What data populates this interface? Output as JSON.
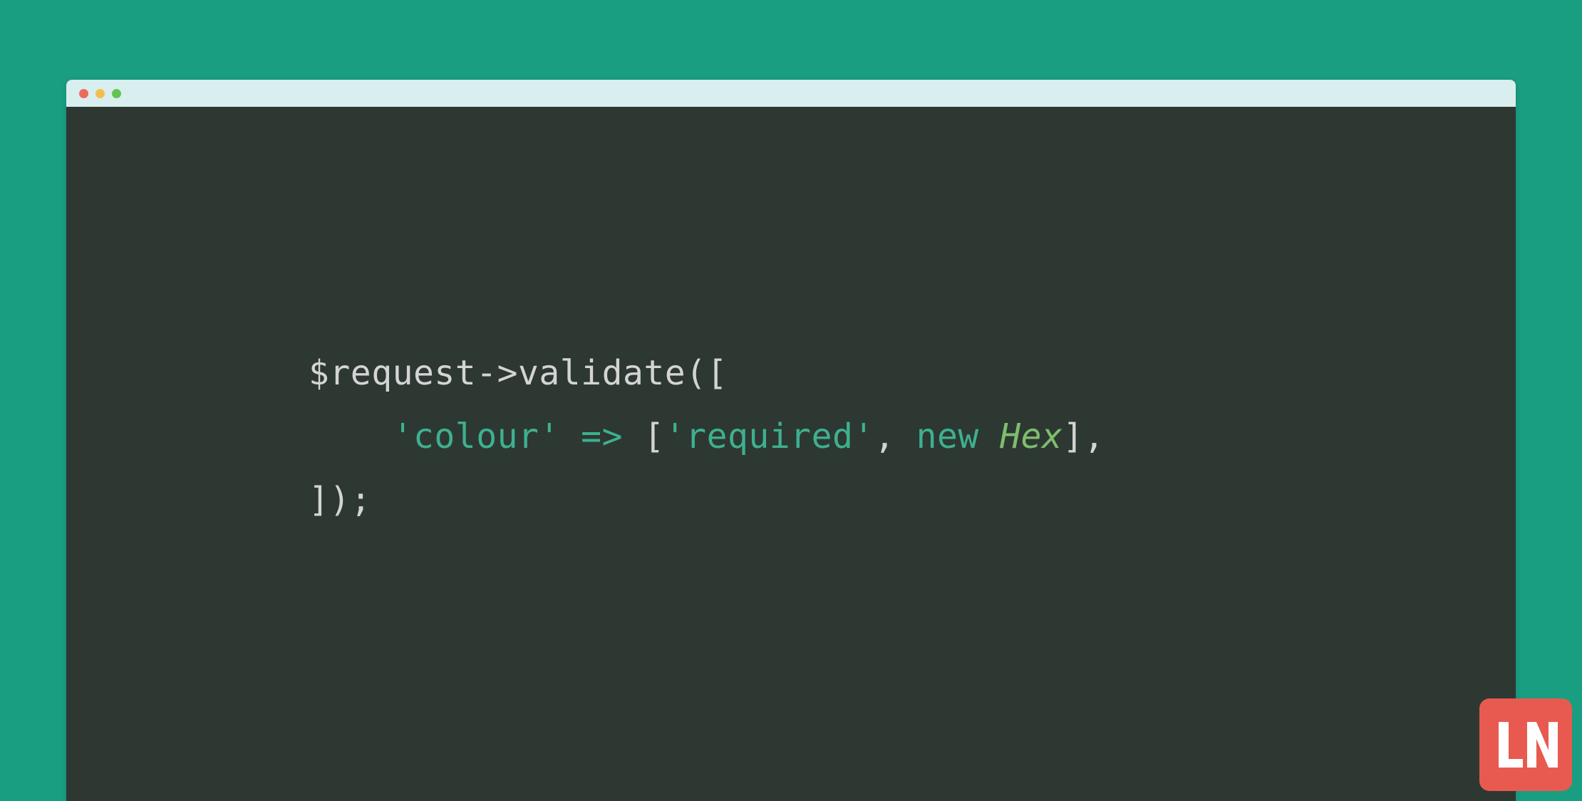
{
  "code": {
    "line1": {
      "variable": "$request",
      "arrow": "->",
      "method": "validate",
      "open": "(["
    },
    "line2": {
      "indent": "    ",
      "key": "'colour'",
      "fat_arrow": " => ",
      "open_bracket": "[",
      "required": "'required'",
      "comma": ", ",
      "new_keyword": "new ",
      "class_name": "Hex",
      "close_bracket": "]",
      "trailing": ","
    },
    "line3": {
      "close": "]);"
    }
  },
  "watermark": {
    "text": "LN"
  },
  "colors": {
    "background": "#1a9e82",
    "editor_bg": "#2d3833",
    "titlebar": "#d9eeee",
    "text_default": "#d4d4d4",
    "text_string": "#3eb08f",
    "text_class": "#7fbd6c",
    "watermark_bg": "#e85a4f"
  }
}
